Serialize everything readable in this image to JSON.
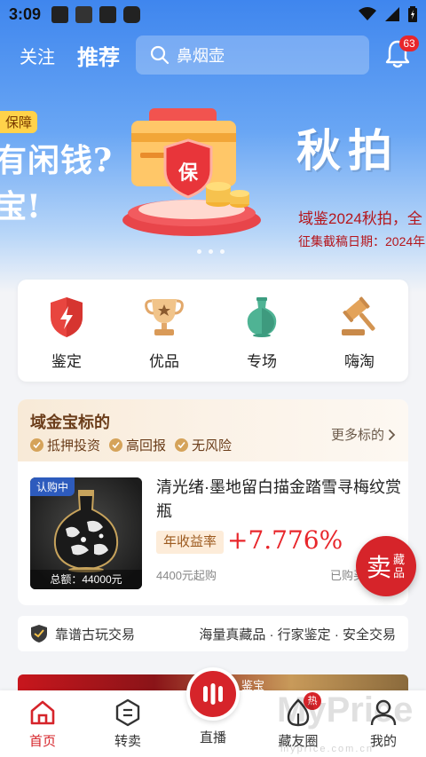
{
  "status_bar": {
    "time": "3:09"
  },
  "header": {
    "tab_follow": "关注",
    "tab_recommend": "推荐",
    "search_placeholder": "鼻烟壶",
    "notification_count": "63"
  },
  "banner": {
    "tag": "保障",
    "slogan_line1": "有闲钱?",
    "slogan_line2": "宝!",
    "shield_text": "保",
    "autumn_title": "秋拍",
    "line1": "域鉴2024秋拍，全",
    "line2": "征集截稿日期：2024年"
  },
  "categories": [
    {
      "label": "鉴定",
      "icon": "shield-bolt-icon"
    },
    {
      "label": "优品",
      "icon": "trophy-icon"
    },
    {
      "label": "专场",
      "icon": "vase-icon"
    },
    {
      "label": "嗨淘",
      "icon": "gavel-icon"
    }
  ],
  "gold_section": {
    "title": "域金宝标的",
    "tags": [
      "抵押投资",
      "高回报",
      "无风险"
    ],
    "more": "更多标的",
    "product": {
      "badge": "认购中",
      "total": "总额：44000元",
      "title": "清光绪·墨地留白描金踏雪寻梅纹赏瓶",
      "yield_label": "年收益率",
      "yield_value": "+7.776%",
      "min_amount": "4400元起购",
      "bought": "已购买"
    }
  },
  "sell_fab": {
    "big": "卖",
    "small": "藏品"
  },
  "trust": {
    "left": "靠谱古玩交易",
    "right": "海量真藏品 · 行家鉴定 · 安全交易"
  },
  "teaser": {
    "label": "鉴宝"
  },
  "nav": {
    "items": [
      {
        "label": "首页"
      },
      {
        "label": "转卖"
      },
      {
        "label": "直播"
      },
      {
        "label": "藏友圈",
        "badge": "热"
      },
      {
        "label": "我的"
      }
    ]
  },
  "watermark": {
    "main": "MyPrice",
    "sub": "myprice.com.cn"
  },
  "colors": {
    "brand_red": "#d6242a",
    "brand_blue": "#3f86ee",
    "gold_text": "#6b3d1a"
  }
}
